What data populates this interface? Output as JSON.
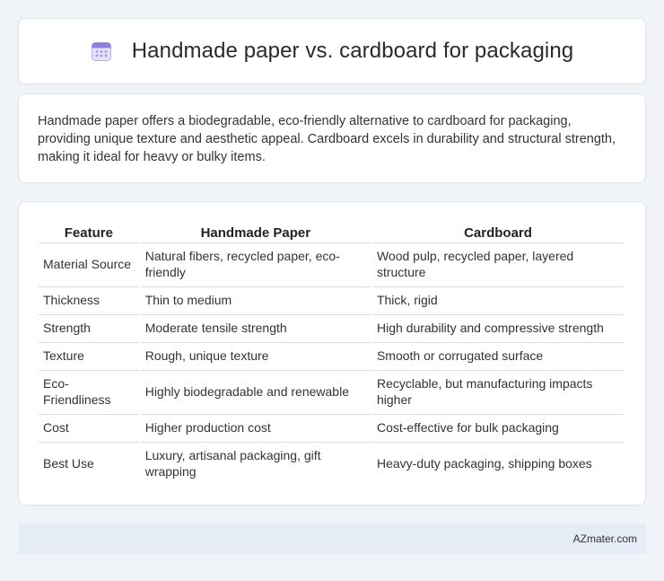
{
  "header": {
    "title": "Handmade paper vs. cardboard for packaging",
    "icon": "calendar-icon",
    "icon_color": "#8e7fd8"
  },
  "summary": {
    "text": "Handmade paper offers a biodegradable, eco-friendly alternative to cardboard for packaging, providing unique texture and aesthetic appeal. Cardboard excels in durability and structural strength, making it ideal for heavy or bulky items."
  },
  "table": {
    "columns": [
      "Feature",
      "Handmade Paper",
      "Cardboard"
    ],
    "rows": [
      [
        "Material Source",
        "Natural fibers, recycled paper, eco-friendly",
        "Wood pulp, recycled paper, layered structure"
      ],
      [
        "Thickness",
        "Thin to medium",
        "Thick, rigid"
      ],
      [
        "Strength",
        "Moderate tensile strength",
        "High durability and compressive strength"
      ],
      [
        "Texture",
        "Rough, unique texture",
        "Smooth or corrugated surface"
      ],
      [
        "Eco-Friendliness",
        "Highly biodegradable and renewable",
        "Recyclable, but manufacturing impacts higher"
      ],
      [
        "Cost",
        "Higher production cost",
        "Cost-effective for bulk packaging"
      ],
      [
        "Best Use",
        "Luxury, artisanal packaging, gift wrapping",
        "Heavy-duty packaging, shipping boxes"
      ]
    ]
  },
  "footer": {
    "source": "AZmater.com"
  },
  "colors": {
    "background": "#f0f3f8",
    "card": "#ffffff",
    "footer_bg": "#e5ecf6",
    "row_border": "#dcdcdc"
  }
}
